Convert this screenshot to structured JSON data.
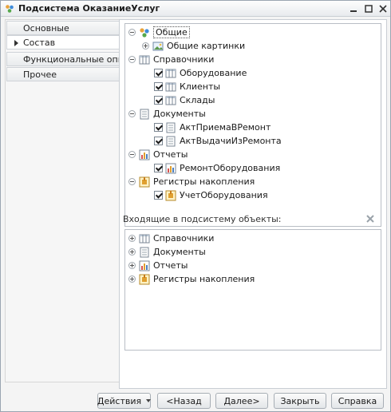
{
  "window": {
    "title": "Подсистема ОказаниеУслуг"
  },
  "nav": {
    "items": [
      {
        "label": "Основные",
        "active": false
      },
      {
        "label": "Состав",
        "active": true
      },
      {
        "label": "Функциональные опции",
        "active": false
      },
      {
        "label": "Прочее",
        "active": false
      }
    ]
  },
  "tree": {
    "general": {
      "label": "Общие",
      "children": {
        "pictures": "Общие картинки"
      }
    },
    "catalogs": {
      "label": "Справочники",
      "children": {
        "equipment": "Оборудование",
        "clients": "Клиенты",
        "warehouses": "Склады"
      }
    },
    "documents": {
      "label": "Документы",
      "children": {
        "act_receive": "АктПриемаВРемонт",
        "act_issue": "АктВыдачиИзРемонта"
      }
    },
    "reports": {
      "label": "Отчеты",
      "children": {
        "repair": "РемонтОборудования"
      }
    },
    "registers": {
      "label": "Регистры накопления",
      "children": {
        "accounting": "УчетОборудования"
      }
    }
  },
  "included": {
    "label": "Входящие в подсистему объекты:",
    "items": {
      "catalogs": "Справочники",
      "documents": "Документы",
      "reports": "Отчеты",
      "registers": "Регистры накопления"
    }
  },
  "buttons": {
    "actions": "Действия",
    "back": "<Назад",
    "next": "Далее>",
    "close": "Закрыть",
    "help": "Справка"
  }
}
